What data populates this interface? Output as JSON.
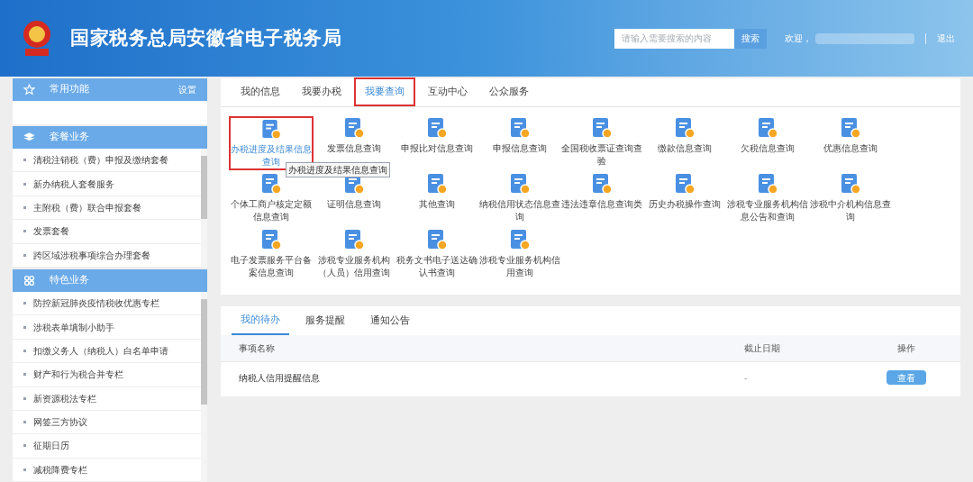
{
  "header": {
    "title": "国家税务总局安徽省电子税务局",
    "search": {
      "placeholder": "请输入需要搜索的内容",
      "button": "搜索"
    },
    "welcome": "欢迎，",
    "logout": "退出"
  },
  "sidebar": [
    {
      "title": "常用功能",
      "action": "设置"
    },
    {
      "title": "套餐业务",
      "items": [
        "清税注销税（费）申报及缴纳套餐",
        "新办纳税人套餐服务",
        "主附税（费）联合申报套餐",
        "发票套餐",
        "跨区域涉税事项综合办理套餐"
      ]
    },
    {
      "title": "特色业务",
      "items": [
        "防控新冠肺炎疫情税收优惠专栏",
        "涉税表单填制小助手",
        "扣缴义务人（纳税人）白名单申请",
        "财产和行为税合并专栏",
        "新资源税法专栏",
        "网签三方协议",
        "征期日历",
        "减税降费专栏"
      ]
    }
  ],
  "main_tabs": [
    {
      "label": "我的信息",
      "selected": false
    },
    {
      "label": "我要办税",
      "selected": false
    },
    {
      "label": "我要查询",
      "selected": true
    },
    {
      "label": "互动中心",
      "selected": false
    },
    {
      "label": "公众服务",
      "selected": false
    }
  ],
  "services": [
    {
      "label": "办税进度及结果信息查询",
      "highlighted": true,
      "tooltip": "办税进度及结果信息查询"
    },
    {
      "label": "发票信息查询",
      "highlighted": false
    },
    {
      "label": "申报比对信息查询",
      "highlighted": false
    },
    {
      "label": "申报信息查询",
      "highlighted": false
    },
    {
      "label": "全国税收票证查询查验",
      "highlighted": false
    },
    {
      "label": "缴款信息查询",
      "highlighted": false
    },
    {
      "label": "欠税信息查询",
      "highlighted": false
    },
    {
      "label": "优惠信息查询",
      "highlighted": false
    },
    {
      "label": "个体工商户核定定额信息查询",
      "highlighted": false
    },
    {
      "label": "证明信息查询",
      "highlighted": false
    },
    {
      "label": "其他查询",
      "highlighted": false
    },
    {
      "label": "纳税信用状态信息查询",
      "highlighted": false
    },
    {
      "label": "违法违章信息查询类",
      "highlighted": false
    },
    {
      "label": "历史办税操作查询",
      "highlighted": false
    },
    {
      "label": "涉税专业服务机构信息公告和查询",
      "highlighted": false
    },
    {
      "label": "涉税中介机构信息查询",
      "highlighted": false
    },
    {
      "label": "电子发票服务平台备案信息查询",
      "highlighted": false
    },
    {
      "label": "涉税专业服务机构（人员）信用查询",
      "highlighted": false
    },
    {
      "label": "税务文书电子送达确认书查询",
      "highlighted": false
    },
    {
      "label": "涉税专业服务机构信用查询",
      "highlighted": false
    }
  ],
  "todo_tabs": [
    {
      "label": "我的待办",
      "selected": true
    },
    {
      "label": "服务提醒",
      "selected": false
    },
    {
      "label": "通知公告",
      "selected": false
    }
  ],
  "todo_table": {
    "columns": [
      "事项名称",
      "截止日期",
      "操作"
    ],
    "rows": [
      {
        "name": "纳税人信用提醒信息",
        "deadline": "-",
        "action": "查看"
      }
    ]
  }
}
